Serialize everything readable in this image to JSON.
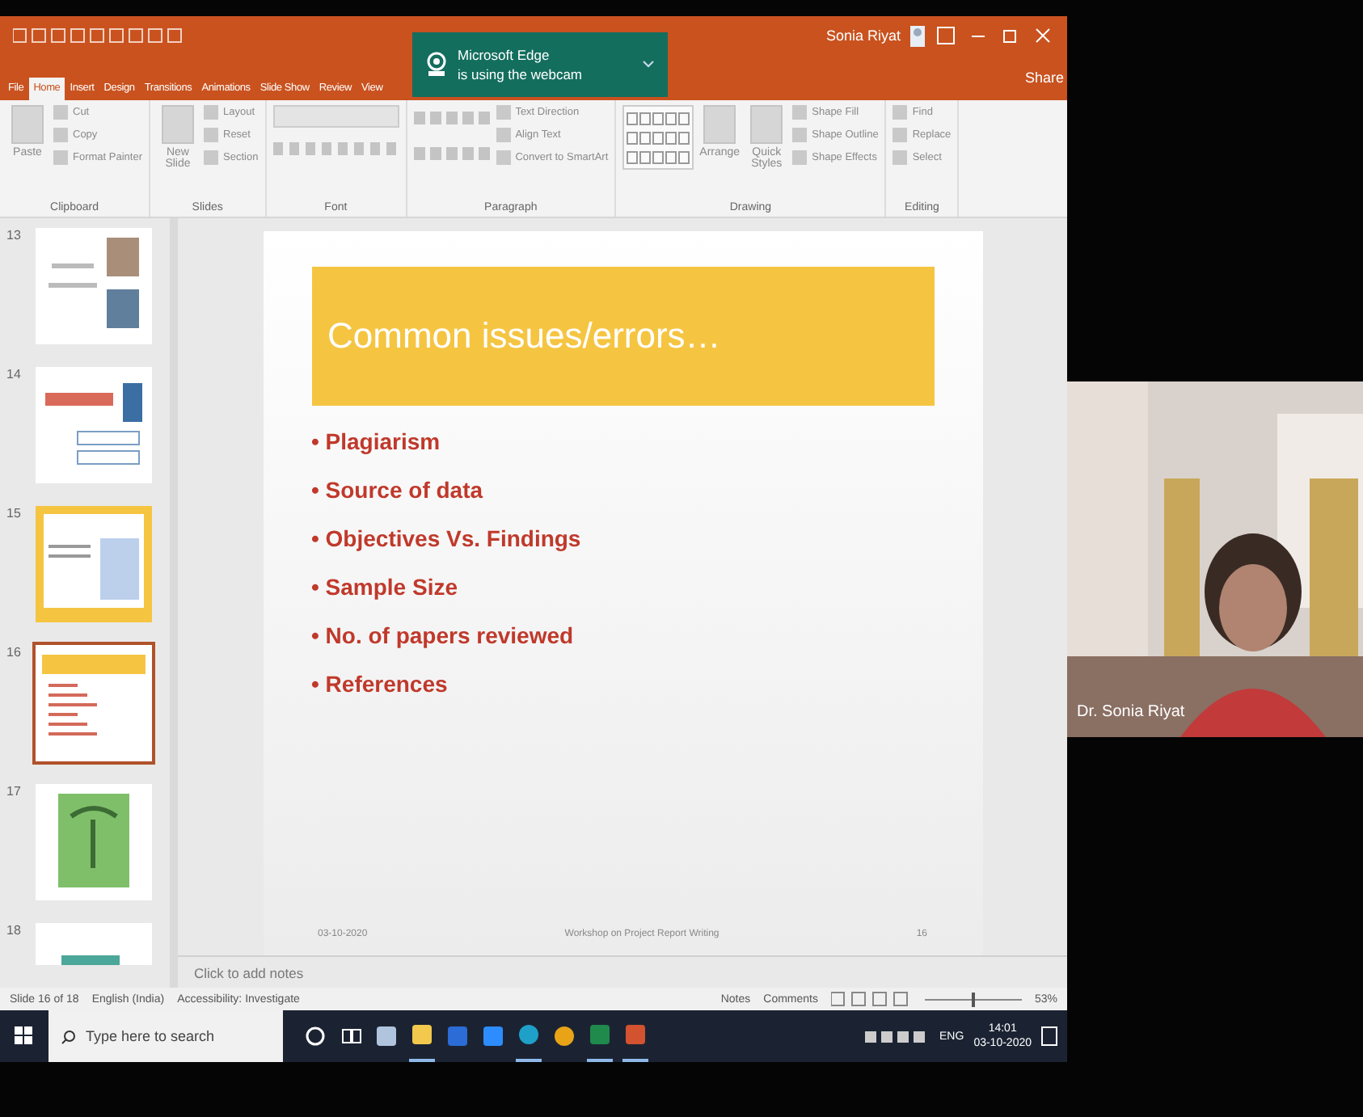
{
  "window": {
    "user": "Sonia Riyat",
    "share": "Share"
  },
  "notification": {
    "title": "Microsoft Edge",
    "message": "is using the webcam"
  },
  "ribbon_tabs": [
    {
      "label": "File",
      "selected": false
    },
    {
      "label": "Home",
      "selected": true
    },
    {
      "label": "Insert",
      "selected": false
    },
    {
      "label": "Design",
      "selected": false
    },
    {
      "label": "Transitions",
      "selected": false
    },
    {
      "label": "Animations",
      "selected": false
    },
    {
      "label": "Slide Show",
      "selected": false
    },
    {
      "label": "Review",
      "selected": false
    },
    {
      "label": "View",
      "selected": false
    }
  ],
  "ribbon_groups": [
    {
      "label": "Clipboard",
      "kind": "commands",
      "large_commands": [
        "Paste"
      ],
      "commands": [
        "Cut",
        "Copy",
        "Format Painter"
      ]
    },
    {
      "label": "Slides",
      "kind": "commands",
      "large_commands": [
        "New Slide"
      ],
      "commands": [
        "Layout",
        "Reset",
        "Section"
      ]
    },
    {
      "label": "Font",
      "kind": "font"
    },
    {
      "label": "Paragraph",
      "kind": "paragraph",
      "commands": [
        "Text Direction",
        "Align Text",
        "Convert to SmartArt"
      ]
    },
    {
      "label": "Drawing",
      "kind": "drawing",
      "large_commands": [
        "Arrange",
        "Quick Styles"
      ],
      "commands": [
        "Shape Fill",
        "Shape Outline",
        "Shape Effects"
      ]
    },
    {
      "label": "Editing",
      "kind": "commands",
      "commands": [
        "Find",
        "Replace",
        "Select"
      ]
    }
  ],
  "slides": [
    {
      "number": "13",
      "kind": "photos",
      "selected": false
    },
    {
      "number": "14",
      "kind": "diagram",
      "selected": false
    },
    {
      "number": "15",
      "kind": "table",
      "selected": false
    },
    {
      "number": "16",
      "kind": "bullets",
      "selected": true
    },
    {
      "number": "17",
      "kind": "picture",
      "selected": false
    },
    {
      "number": "18",
      "kind": "art",
      "selected": false
    }
  ],
  "current_slide": {
    "title": "Common issues/errors…",
    "bullets": [
      "• Plagiarism",
      "• Source of data",
      "• Objectives Vs. Findings",
      "• Sample Size",
      "• No. of papers reviewed",
      "• References"
    ],
    "footer_date": "03-10-2020",
    "footer_text": "Workshop on Project Report Writing",
    "number": "16"
  },
  "notes": {
    "placeholder": "Click to add notes"
  },
  "status_bar": {
    "slide_info": "Slide 16 of 18",
    "language": "English (India)",
    "accessibility": "Accessibility: Investigate",
    "notes": "Notes",
    "comments": "Comments",
    "zoom": {
      "level": 0.5,
      "reading": "53%"
    }
  },
  "taskbar": {
    "search_placeholder": "Type here to search",
    "apps": [
      {
        "kind": "cortana",
        "open": false
      },
      {
        "kind": "task-view",
        "open": false
      },
      {
        "kind": "paint",
        "open": false
      },
      {
        "kind": "folder",
        "open": true
      },
      {
        "kind": "word",
        "open": false
      },
      {
        "kind": "zoom",
        "open": false
      },
      {
        "kind": "edge",
        "open": true
      },
      {
        "kind": "chrome",
        "open": false
      },
      {
        "kind": "excel",
        "open": true
      },
      {
        "kind": "powerpoint",
        "open": true
      }
    ],
    "language": "ENG",
    "time": "14:01",
    "date": "03-10-2020"
  },
  "webcam": {
    "name": "Dr. Sonia Riyat"
  }
}
